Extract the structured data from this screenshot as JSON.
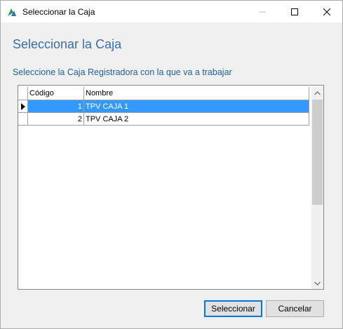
{
  "window": {
    "title": "Seleccionar la Caja",
    "controls": [
      "minimize-icon",
      "maximize-icon",
      "close-icon"
    ]
  },
  "heading": "Seleccionar la Caja",
  "subheading": "Seleccione la Caja Registradora con la que va a trabajar",
  "grid": {
    "columns": [
      "Código",
      "Nombre"
    ],
    "rows": [
      {
        "codigo": "1",
        "nombre": "TPV CAJA 1",
        "selected": true
      },
      {
        "codigo": "2",
        "nombre": "TPV CAJA 2",
        "selected": false
      }
    ]
  },
  "buttons": {
    "select_label": "Seleccionar",
    "cancel_label": "Cancelar"
  },
  "colors": {
    "heading": "#3a6ea5",
    "selection": "#3399ff",
    "default_button_border": "#0078d7"
  }
}
